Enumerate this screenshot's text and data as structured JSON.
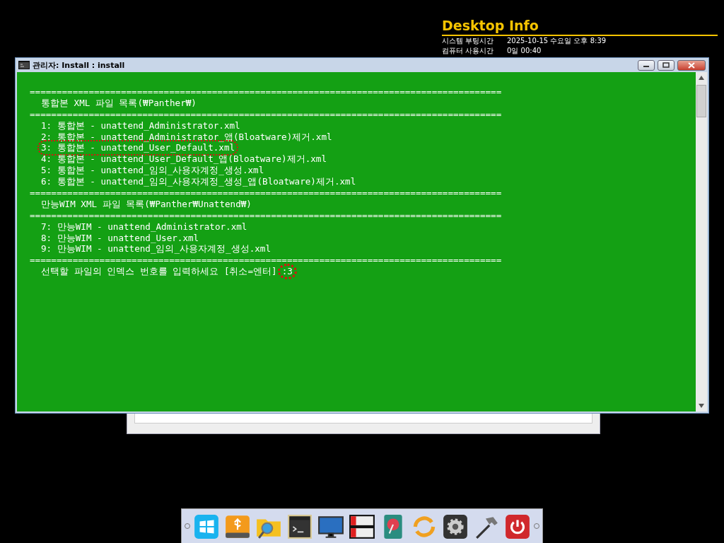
{
  "desktop_info": {
    "title": "Desktop Info",
    "rows": [
      {
        "label": "시스템 부팅시간",
        "value": "2025-10-15 수요일 오후 8:39"
      },
      {
        "label": "컴퓨터 사용시간",
        "value": "0일 00:40"
      }
    ]
  },
  "window": {
    "title": "관리자: Install : install"
  },
  "console": {
    "lines": [
      {
        "kind": "rule",
        "text": "========================================================================================"
      },
      {
        "kind": "heading",
        "text": "통합본 XML 파일 목록(₩Panther₩)"
      },
      {
        "kind": "rule",
        "text": "========================================================================================"
      },
      {
        "kind": "item",
        "text": "1: 통합본 - unattend_Administrator.xml",
        "highlighted": false
      },
      {
        "kind": "item",
        "text": "2: 통합본 - unattend_Administrator_앱(Bloatware)제거.xml",
        "highlighted": false
      },
      {
        "kind": "item",
        "text": "3: 통합본 - unattend_User_Default.xml",
        "highlighted": true
      },
      {
        "kind": "item",
        "text": "4: 통합본 - unattend_User_Default_앱(Bloatware)제거.xml",
        "highlighted": false
      },
      {
        "kind": "item",
        "text": "5: 통합본 - unattend_임의_사용자계정_생성.xml",
        "highlighted": false
      },
      {
        "kind": "item",
        "text": "6: 통합본 - unattend_임의_사용자계정_생성_앱(Bloatware)제거.xml",
        "highlighted": false
      },
      {
        "kind": "rule",
        "text": "========================================================================================"
      },
      {
        "kind": "heading",
        "text": "만능WIM XML 파일 목록(₩Panther₩Unattend₩)"
      },
      {
        "kind": "rule",
        "text": "========================================================================================"
      },
      {
        "kind": "item",
        "text": "7: 만능WIM - unattend_Administrator.xml",
        "highlighted": false
      },
      {
        "kind": "item",
        "text": "8: 만능WIM - unattend_User.xml",
        "highlighted": false
      },
      {
        "kind": "item",
        "text": "9: 만능WIM - unattend_임의_사용자계정_생성.xml",
        "highlighted": false
      },
      {
        "kind": "rule",
        "text": "========================================================================================"
      },
      {
        "kind": "prompt",
        "text": "선택할 파일의 인덱스 번호를 입력하세요 [취소=엔터]",
        "input": ":3",
        "highlighted": true
      }
    ]
  }
}
